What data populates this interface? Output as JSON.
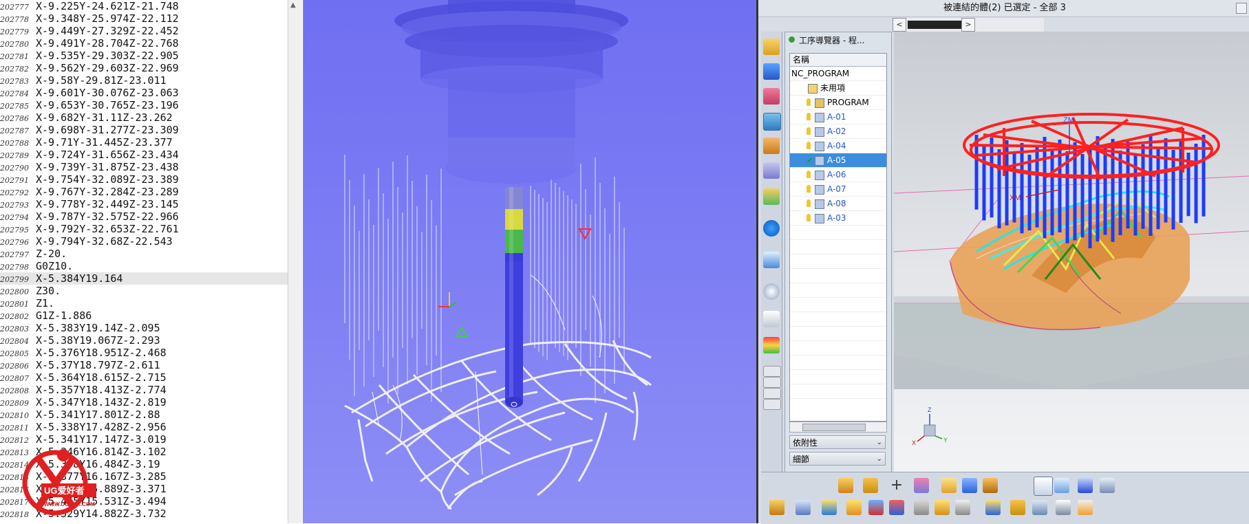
{
  "gcode": {
    "lines": [
      {
        "n": "202777",
        "code": "X-9.225Y-24.621Z-21.748"
      },
      {
        "n": "202778",
        "code": "X-9.348Y-25.974Z-22.112"
      },
      {
        "n": "202779",
        "code": "X-9.449Y-27.329Z-22.452"
      },
      {
        "n": "202780",
        "code": "X-9.491Y-28.704Z-22.768"
      },
      {
        "n": "202781",
        "code": "X-9.535Y-29.303Z-22.905"
      },
      {
        "n": "202782",
        "code": "X-9.562Y-29.603Z-22.969"
      },
      {
        "n": "202783",
        "code": "X-9.58Y-29.81Z-23.011"
      },
      {
        "n": "202784",
        "code": "X-9.601Y-30.076Z-23.063"
      },
      {
        "n": "202785",
        "code": "X-9.653Y-30.765Z-23.196"
      },
      {
        "n": "202786",
        "code": "X-9.682Y-31.11Z-23.262"
      },
      {
        "n": "202787",
        "code": "X-9.698Y-31.277Z-23.309"
      },
      {
        "n": "202788",
        "code": "X-9.71Y-31.445Z-23.377"
      },
      {
        "n": "202789",
        "code": "X-9.724Y-31.656Z-23.434"
      },
      {
        "n": "202790",
        "code": "X-9.739Y-31.875Z-23.438"
      },
      {
        "n": "202791",
        "code": "X-9.754Y-32.089Z-23.389"
      },
      {
        "n": "202792",
        "code": "X-9.767Y-32.284Z-23.289"
      },
      {
        "n": "202793",
        "code": "X-9.778Y-32.449Z-23.145"
      },
      {
        "n": "202794",
        "code": "X-9.787Y-32.575Z-22.966"
      },
      {
        "n": "202795",
        "code": "X-9.792Y-32.653Z-22.761"
      },
      {
        "n": "202796",
        "code": "X-9.794Y-32.68Z-22.543"
      },
      {
        "n": "202797",
        "code": "Z-20."
      },
      {
        "n": "202798",
        "code": "G0Z10."
      },
      {
        "n": "202799",
        "code": "X-5.384Y19.164",
        "highlight": true
      },
      {
        "n": "202800",
        "code": "Z30."
      },
      {
        "n": "202801",
        "code": "Z1."
      },
      {
        "n": "202802",
        "code": "G1Z-1.886"
      },
      {
        "n": "202803",
        "code": "X-5.383Y19.14Z-2.095"
      },
      {
        "n": "202804",
        "code": "X-5.38Y19.067Z-2.293"
      },
      {
        "n": "202805",
        "code": "X-5.376Y18.951Z-2.468"
      },
      {
        "n": "202806",
        "code": "X-5.37Y18.797Z-2.611"
      },
      {
        "n": "202807",
        "code": "X-5.364Y18.615Z-2.715"
      },
      {
        "n": "202808",
        "code": "X-5.357Y18.413Z-2.774"
      },
      {
        "n": "202809",
        "code": "X-5.347Y18.143Z-2.819"
      },
      {
        "n": "202810",
        "code": "X-5.341Y17.801Z-2.88"
      },
      {
        "n": "202811",
        "code": "X-5.338Y17.428Z-2.956"
      },
      {
        "n": "202812",
        "code": "X-5.341Y17.147Z-3.019"
      },
      {
        "n": "202813",
        "code": "X-5.346Y16.814Z-3.102"
      },
      {
        "n": "202814",
        "code": "X-5.358Y16.484Z-3.19"
      },
      {
        "n": "202815",
        "code": "X-5.377Y16.167Z-3.285"
      },
      {
        "n": "202816",
        "code": "X-5.402Y15.889Z-3.371"
      },
      {
        "n": "202817",
        "code": "X-5.445Y15.531Z-3.494"
      },
      {
        "n": "202818",
        "code": "X-5.529Y14.882Z-3.732"
      }
    ]
  },
  "watermark": {
    "brand": "UG爱好者",
    "url": "WWW.UGSNX.COM"
  },
  "nx": {
    "title": "被連結的體(2) 已選定 - 全部 3",
    "scroll_left": "<",
    "scroll_right": ">",
    "navigator": {
      "title": "工序導覽器 - 程...",
      "column_name": "名稱",
      "tree": [
        {
          "label": "NC_PROGRAM",
          "indent": 0,
          "type": "root"
        },
        {
          "label": "未用項",
          "indent": 1,
          "type": "folder"
        },
        {
          "label": "PROGRAM",
          "indent": 2,
          "type": "program"
        },
        {
          "label": "A-01",
          "indent": 2,
          "type": "op"
        },
        {
          "label": "A-02",
          "indent": 2,
          "type": "op"
        },
        {
          "label": "A-04",
          "indent": 2,
          "type": "op"
        },
        {
          "label": "A-05",
          "indent": 2,
          "type": "op",
          "selected": true,
          "status": "ok"
        },
        {
          "label": "A-06",
          "indent": 2,
          "type": "op-plain"
        },
        {
          "label": "A-07",
          "indent": 2,
          "type": "op"
        },
        {
          "label": "A-08",
          "indent": 2,
          "type": "op"
        },
        {
          "label": "A-03",
          "indent": 2,
          "type": "op"
        }
      ],
      "panel_dependencies": "依附性",
      "panel_details": "細節",
      "panel_chevron": "⌄"
    },
    "viewport": {
      "label_zm": "ZM",
      "label_xm": "XM",
      "triad_z": "Z",
      "triad_x": "X",
      "triad_y": "Y"
    }
  },
  "colors": {
    "sim_bg": "#7373f3",
    "tool_holder": "#5a5ae6",
    "toolpath_white": "#f2f2f2",
    "nx_red": "#ff2020",
    "nx_blue": "#1a3cff",
    "nx_cyan": "#22e6e6",
    "nx_part": "#e6a055",
    "nx_select": "#3c8dde"
  }
}
